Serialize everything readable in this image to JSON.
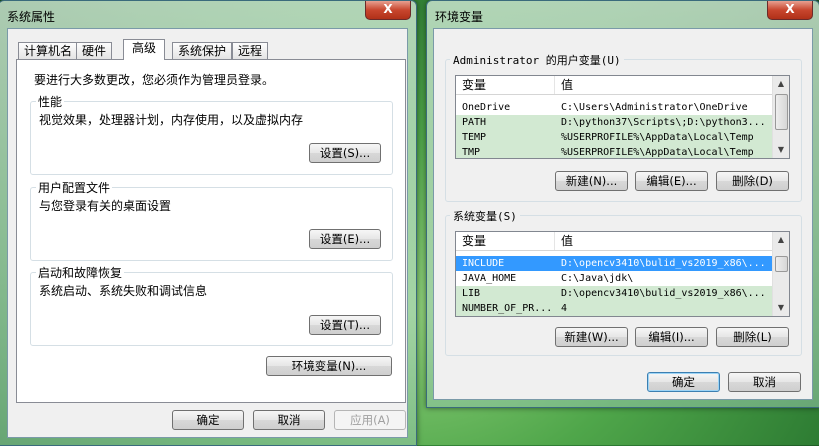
{
  "left_window": {
    "title": "系统属性",
    "close_label": "X",
    "tabs": [
      "计算机名",
      "硬件",
      "高级",
      "系统保护",
      "远程"
    ],
    "notice": "要进行大多数更改，您必须作为管理员登录。",
    "groups": [
      {
        "title": "性能",
        "desc": "视觉效果，处理器计划，内存使用，以及虚拟内存",
        "button": "设置(S)..."
      },
      {
        "title": "用户配置文件",
        "desc": "与您登录有关的桌面设置",
        "button": "设置(E)..."
      },
      {
        "title": "启动和故障恢复",
        "desc": "系统启动、系统失败和调试信息",
        "button": "设置(T)..."
      }
    ],
    "env_button": "环境变量(N)...",
    "ok": "确定",
    "cancel": "取消",
    "apply": "应用(A)"
  },
  "right_window": {
    "title": "环境变量",
    "close_label": "X",
    "user_section": {
      "legend": "Administrator 的用户变量(U)",
      "col_var": "变量",
      "col_val": "值",
      "rows": [
        {
          "name": "OneDrive",
          "value": "C:\\Users\\Administrator\\OneDrive"
        },
        {
          "name": "PATH",
          "value": "D:\\python37\\Scripts\\;D:\\python3..."
        },
        {
          "name": "TEMP",
          "value": "%USERPROFILE%\\AppData\\Local\\Temp"
        },
        {
          "name": "TMP",
          "value": "%USERPROFILE%\\AppData\\Local\\Temp"
        }
      ],
      "new": "新建(N)...",
      "edit": "编辑(E)...",
      "delete": "删除(D)"
    },
    "system_section": {
      "legend": "系统变量(S)",
      "col_var": "变量",
      "col_val": "值",
      "rows": [
        {
          "name": "INCLUDE",
          "value": "D:\\opencv3410\\bulid_vs2019_x86\\..."
        },
        {
          "name": "JAVA_HOME",
          "value": "C:\\Java\\jdk\\"
        },
        {
          "name": "LIB",
          "value": "D:\\opencv3410\\bulid_vs2019_x86\\..."
        },
        {
          "name": "NUMBER_OF_PR...",
          "value": "4"
        }
      ],
      "new": "新建(W)...",
      "edit": "编辑(I)...",
      "delete": "删除(L)"
    },
    "ok": "确定",
    "cancel": "取消"
  }
}
